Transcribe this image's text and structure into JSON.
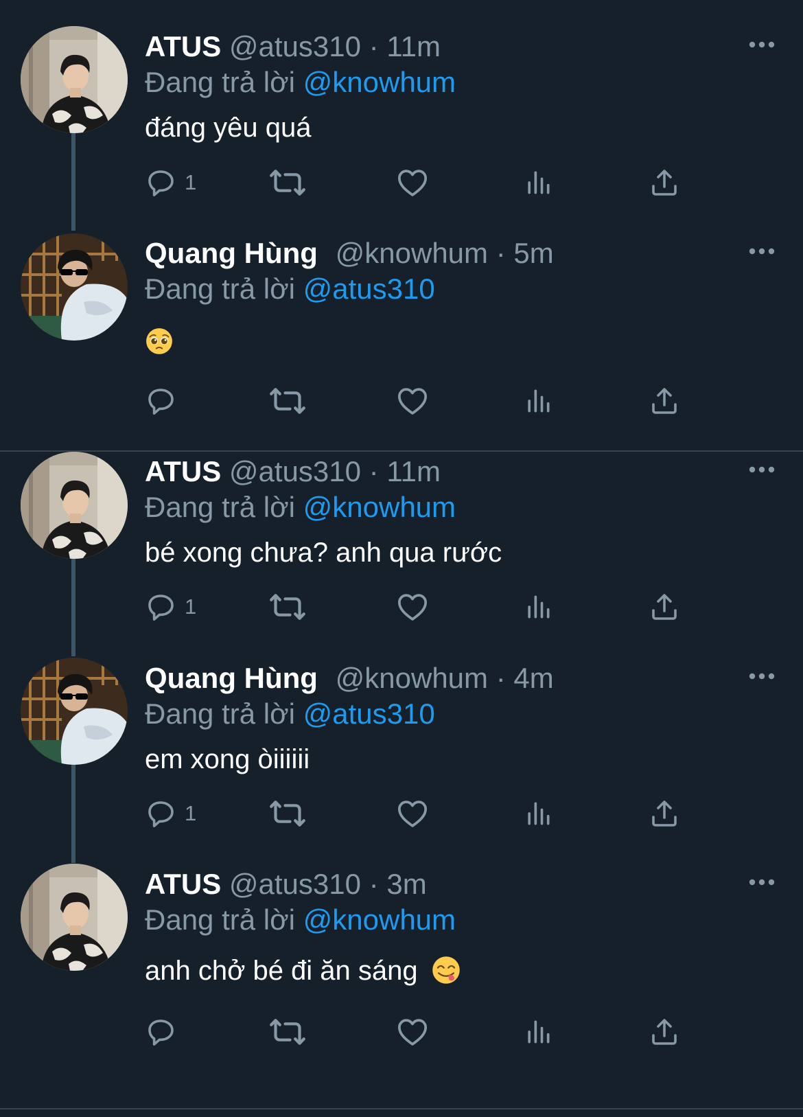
{
  "colors": {
    "background": "#15202b",
    "primary_text": "#ffffff",
    "secondary_text": "#8899a6",
    "mention": "#1d9bf0",
    "thread_line": "#3d5466",
    "divider": "#38444d"
  },
  "reply_prefix": "Đang trả lời",
  "tweets": [
    {
      "name": "ATUS",
      "handle": "@atus310",
      "dot": "·",
      "time": "11m",
      "mention": "@knowhum",
      "text": "đáng yêu quá",
      "reply_count": "1",
      "avatar": "atus-avatar",
      "emoji": ""
    },
    {
      "name": "Quang Hùng",
      "handle": "@knowhum",
      "dot": "·",
      "time": "5m",
      "mention": "@atus310",
      "text": "",
      "reply_count": "",
      "avatar": "quanghung-avatar",
      "emoji": "pleading-face-emoji"
    },
    {
      "name": "ATUS",
      "handle": "@atus310",
      "dot": "·",
      "time": "11m",
      "mention": "@knowhum",
      "text": "bé xong chưa? anh qua rước",
      "reply_count": "1",
      "avatar": "atus-avatar",
      "emoji": ""
    },
    {
      "name": "Quang Hùng",
      "handle": "@knowhum",
      "dot": "·",
      "time": "4m",
      "mention": "@atus310",
      "text": "em xong òiiiiii",
      "reply_count": "1",
      "avatar": "quanghung-avatar",
      "emoji": ""
    },
    {
      "name": "ATUS",
      "handle": "@atus310",
      "dot": "·",
      "time": "3m",
      "mention": "@knowhum",
      "text": "anh chở bé đi ăn sáng",
      "reply_count": "",
      "avatar": "atus-avatar",
      "emoji": "yum-face-emoji"
    }
  ],
  "action_icons": [
    "reply-icon",
    "retweet-icon",
    "like-icon",
    "analytics-icon",
    "share-icon"
  ],
  "more_icon": "more-options-icon"
}
